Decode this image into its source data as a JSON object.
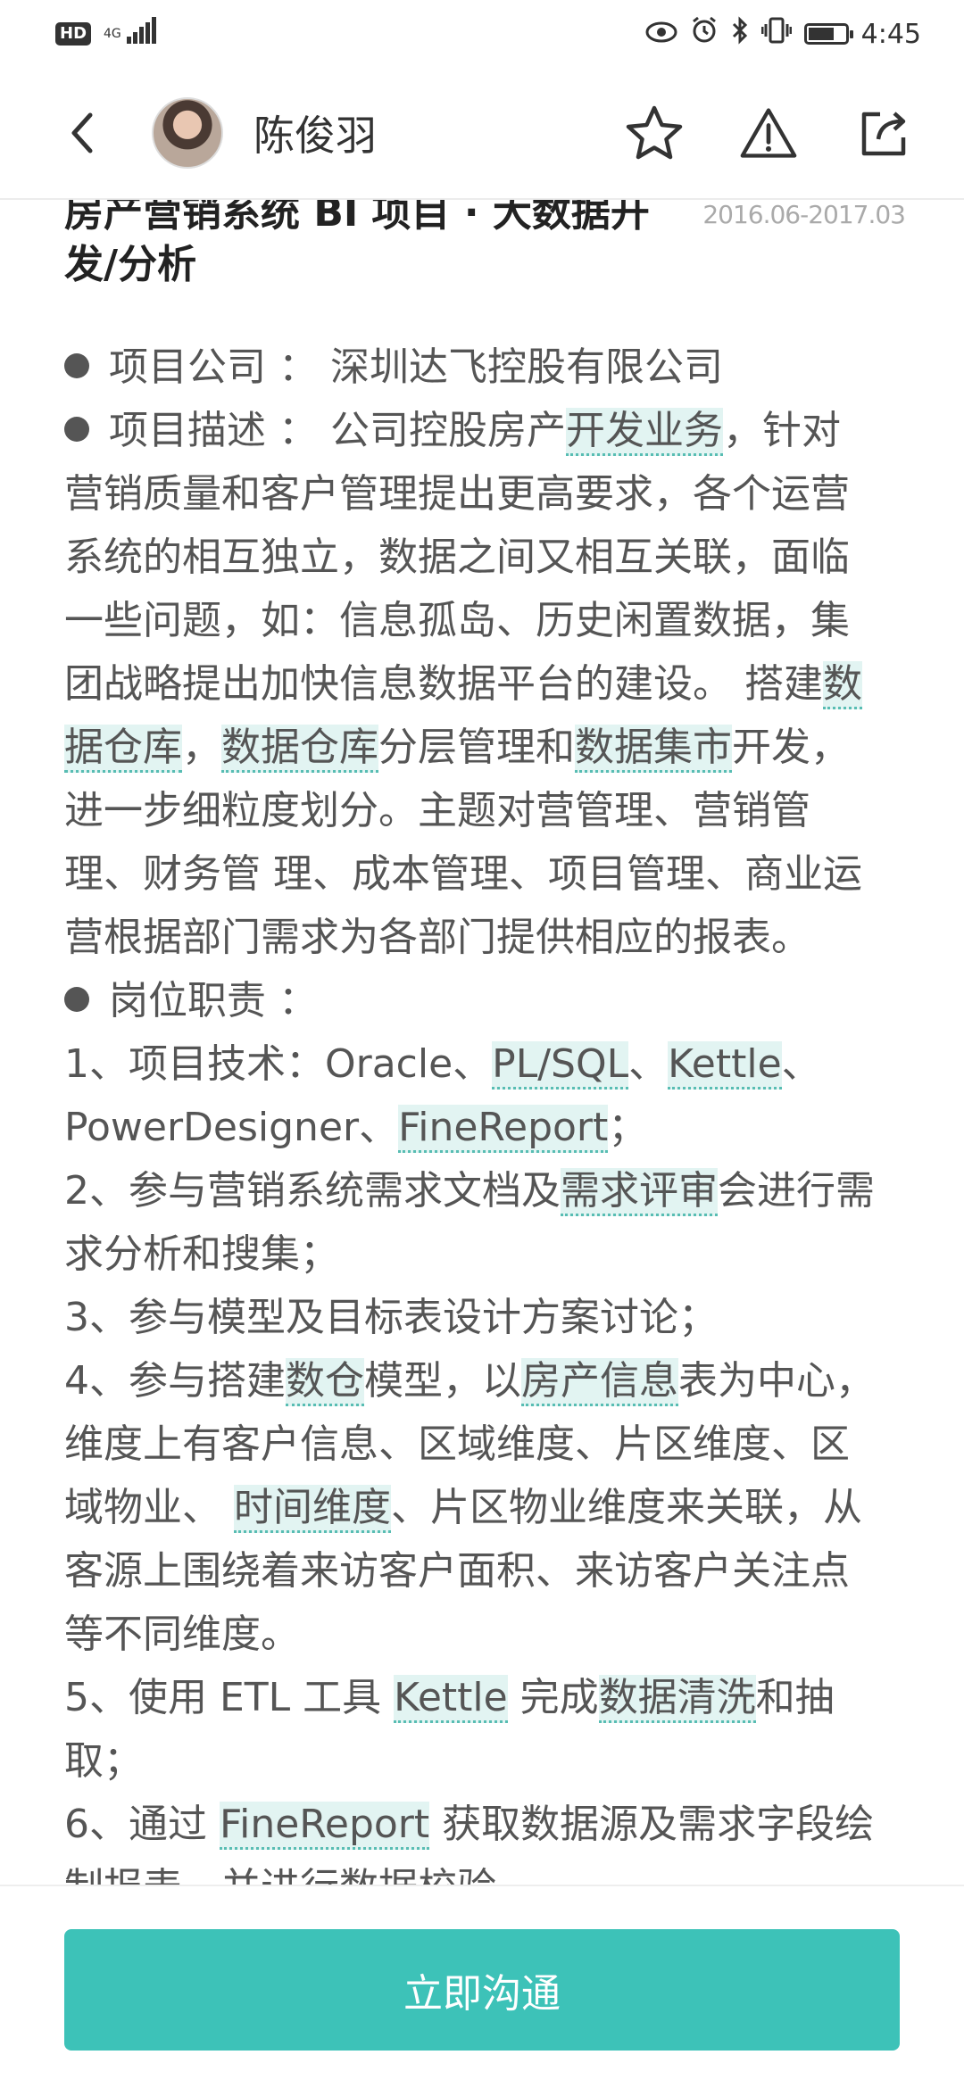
{
  "status_bar": {
    "hd": "HD",
    "network": "4G",
    "time": "4:45",
    "battery_level": 0.7
  },
  "header": {
    "contact_name": "陈俊羽",
    "icons": [
      "back-arrow-icon",
      "star-icon",
      "warning-icon",
      "share-icon"
    ]
  },
  "project": {
    "title": "房产营销系统 BI 项目 · 大数据开发/分析",
    "title_line1": "房产营销系统 BI 项目 · 大数据开",
    "title_line2": "发/分析",
    "date": "2016.06-2017.03"
  },
  "lines": [
    {
      "bullet": true,
      "segs": [
        {
          "t": "项目公司 ： 深圳达飞控股有限公司"
        }
      ]
    },
    {
      "bullet": true,
      "segs": [
        {
          "t": "项目描述 ： 公司控股房产"
        },
        {
          "t": "开发业务",
          "kw": true
        },
        {
          "t": "，针对"
        }
      ]
    },
    {
      "segs": [
        {
          "t": "营销质量和客户管理提出更高要求，各个运营"
        }
      ]
    },
    {
      "segs": [
        {
          "t": "系统的相互独立，数据之间又相互关联，面临"
        }
      ]
    },
    {
      "segs": [
        {
          "t": "一些问题，如：信息孤岛、历史闲置数据，集"
        }
      ]
    },
    {
      "segs": [
        {
          "t": "团战略提出加快信息数据平台的建设。 搭建"
        },
        {
          "t": "数",
          "kw": true
        }
      ]
    },
    {
      "segs": [
        {
          "t": "据仓库",
          "kw": true
        },
        {
          "t": "，"
        },
        {
          "t": "数据仓库",
          "kw": true
        },
        {
          "t": "分层管理和"
        },
        {
          "t": "数据集市",
          "kw": true
        },
        {
          "t": "开发，"
        }
      ]
    },
    {
      "segs": [
        {
          "t": "进一步细粒度划分。主题对营管理、营销管"
        }
      ]
    },
    {
      "segs": [
        {
          "t": "理、财务管 理、成本管理、项目管理、商业运"
        }
      ]
    },
    {
      "segs": [
        {
          "t": "营根据部门需求为各部门提供相应的报表。"
        }
      ]
    },
    {
      "bullet": true,
      "segs": [
        {
          "t": "岗位职责 ："
        }
      ]
    },
    {
      "segs": [
        {
          "t": "1、项目技术：Oracle、"
        },
        {
          "t": "PL/SQL",
          "kw": true
        },
        {
          "t": "、"
        },
        {
          "t": "Kettle",
          "kw": true
        },
        {
          "t": "、"
        }
      ]
    },
    {
      "segs": [
        {
          "t": "PowerDesigner、"
        },
        {
          "t": "FineReport",
          "kw": true
        },
        {
          "t": "；"
        }
      ]
    },
    {
      "segs": [
        {
          "t": "2、参与营销系统需求文档及"
        },
        {
          "t": "需求评审",
          "kw": true
        },
        {
          "t": "会进行需"
        }
      ]
    },
    {
      "segs": [
        {
          "t": "求分析和搜集；"
        }
      ]
    },
    {
      "segs": [
        {
          "t": "3、参与模型及目标表设计方案讨论；"
        }
      ]
    },
    {
      "segs": [
        {
          "t": "4、参与搭建"
        },
        {
          "t": "数仓",
          "kw": true
        },
        {
          "t": "模型，以"
        },
        {
          "t": "房产信息",
          "kw": true
        },
        {
          "t": "表为中心，"
        }
      ]
    },
    {
      "segs": [
        {
          "t": "维度上有客户信息、区域维度、片区维度、区"
        }
      ]
    },
    {
      "segs": [
        {
          "t": "域物业、 "
        },
        {
          "t": "时间维度",
          "kw": true
        },
        {
          "t": "、片区物业维度来关联，从"
        }
      ]
    },
    {
      "segs": [
        {
          "t": "客源上围绕着来访客户面积、来访客户关注点"
        }
      ]
    },
    {
      "segs": [
        {
          "t": "等不同维度。"
        }
      ]
    },
    {
      "segs": [
        {
          "t": "5、使用 ETL 工具 "
        },
        {
          "t": "Kettle",
          "kw": true
        },
        {
          "t": " 完成"
        },
        {
          "t": "数据清洗",
          "kw": true
        },
        {
          "t": "和抽"
        }
      ]
    },
    {
      "segs": [
        {
          "t": "取；"
        }
      ]
    },
    {
      "segs": [
        {
          "t": "6、通过 "
        },
        {
          "t": "FineReport",
          "kw": true
        },
        {
          "t": " 获取数据源及需求字段绘"
        }
      ]
    },
    {
      "segs": [
        {
          "t": "制报表，并进行数据校验"
        }
      ]
    }
  ],
  "footer": {
    "cta_label": "立即沟通"
  },
  "colors": {
    "accent": "#3dc2b8",
    "keyword_bg": "#e2f4f2",
    "keyword_underline": "#58bdb3"
  }
}
